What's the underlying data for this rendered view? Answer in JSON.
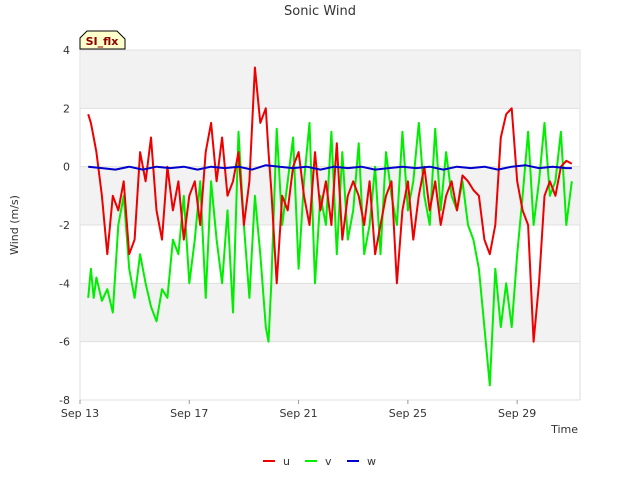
{
  "chart_data": {
    "type": "line",
    "title": "Sonic Wind",
    "badge": "SI_flx",
    "xlabel": "Time",
    "ylabel": "Wind (m/s)",
    "ylim": [
      -8,
      4
    ],
    "yticks": [
      "4",
      "2",
      "0",
      "-2",
      "-4",
      "-6",
      "-8"
    ],
    "x_ticks": [
      {
        "label": "Sep 13",
        "day": 13
      },
      {
        "label": "Sep 17",
        "day": 17
      },
      {
        "label": "Sep 21",
        "day": 21
      },
      {
        "label": "Sep 25",
        "day": 25
      },
      {
        "label": "Sep 29",
        "day": 29
      }
    ],
    "xlim_days": [
      13,
      31.3
    ],
    "grid": "horizontal bands",
    "legend_position": "bottom-center",
    "series": [
      {
        "name": "u",
        "color": "#ee0000",
        "x": [
          13.3,
          13.4,
          13.5,
          13.6,
          13.8,
          14.0,
          14.2,
          14.4,
          14.6,
          14.8,
          15.0,
          15.2,
          15.4,
          15.6,
          15.8,
          16.0,
          16.2,
          16.4,
          16.6,
          16.8,
          17.0,
          17.2,
          17.4,
          17.6,
          17.8,
          18.0,
          18.2,
          18.4,
          18.6,
          18.8,
          19.0,
          19.2,
          19.4,
          19.6,
          19.8,
          19.9,
          20.0,
          20.2,
          20.4,
          20.6,
          20.8,
          21.0,
          21.2,
          21.4,
          21.6,
          21.8,
          22.0,
          22.2,
          22.4,
          22.6,
          22.8,
          23.0,
          23.2,
          23.4,
          23.6,
          23.8,
          24.0,
          24.2,
          24.4,
          24.6,
          24.8,
          25.0,
          25.2,
          25.4,
          25.6,
          25.8,
          26.0,
          26.2,
          26.4,
          26.6,
          26.8,
          27.0,
          27.2,
          27.4,
          27.6,
          27.8,
          28.0,
          28.2,
          28.4,
          28.6,
          28.8,
          29.0,
          29.2,
          29.4,
          29.6,
          29.8,
          30.0,
          30.2,
          30.4,
          30.6,
          30.8,
          31.0
        ],
        "y": [
          1.8,
          1.5,
          1.0,
          0.5,
          -1.0,
          -3.0,
          -1.0,
          -1.5,
          -0.5,
          -3.0,
          -2.5,
          0.5,
          -0.5,
          1.0,
          -1.5,
          -2.5,
          0.0,
          -1.5,
          -0.5,
          -2.5,
          -1.0,
          -0.5,
          -2.0,
          0.5,
          1.5,
          -0.5,
          1.0,
          -1.0,
          -0.5,
          0.5,
          -2.0,
          -0.5,
          3.4,
          1.5,
          2.0,
          0.5,
          -0.8,
          -4.0,
          -1.0,
          -1.5,
          0.0,
          0.5,
          -1.0,
          -2.0,
          0.5,
          -1.5,
          -0.5,
          -2.0,
          0.8,
          -2.5,
          -1.0,
          -0.5,
          -1.0,
          -2.0,
          -0.5,
          -3.0,
          -2.0,
          -1.0,
          -0.5,
          -4.0,
          -1.5,
          -0.5,
          -2.5,
          -1.0,
          0.0,
          -1.5,
          -0.5,
          -2.0,
          -1.0,
          -0.5,
          -1.5,
          -0.3,
          -0.5,
          -0.8,
          -1.0,
          -2.5,
          -3.0,
          -2.0,
          1.0,
          1.8,
          2.0,
          -0.5,
          -1.5,
          -2.0,
          -6.0,
          -4.0,
          -1.0,
          -0.5,
          -1.0,
          0.0,
          0.2,
          0.1
        ]
      },
      {
        "name": "v",
        "color": "#00ee00",
        "x": [
          13.3,
          13.4,
          13.5,
          13.6,
          13.8,
          14.0,
          14.2,
          14.4,
          14.6,
          14.8,
          15.0,
          15.2,
          15.4,
          15.6,
          15.8,
          16.0,
          16.2,
          16.4,
          16.6,
          16.8,
          17.0,
          17.2,
          17.4,
          17.6,
          17.8,
          18.0,
          18.2,
          18.4,
          18.6,
          18.8,
          19.0,
          19.2,
          19.4,
          19.6,
          19.8,
          19.9,
          20.0,
          20.2,
          20.4,
          20.6,
          20.8,
          21.0,
          21.2,
          21.4,
          21.6,
          21.8,
          22.0,
          22.2,
          22.4,
          22.6,
          22.8,
          23.0,
          23.2,
          23.4,
          23.6,
          23.8,
          24.0,
          24.2,
          24.4,
          24.6,
          24.8,
          25.0,
          25.2,
          25.4,
          25.6,
          25.8,
          26.0,
          26.2,
          26.4,
          26.6,
          26.8,
          27.0,
          27.2,
          27.4,
          27.6,
          27.8,
          28.0,
          28.2,
          28.4,
          28.6,
          28.8,
          29.0,
          29.2,
          29.4,
          29.6,
          29.8,
          30.0,
          30.2,
          30.4,
          30.6,
          30.8,
          31.0
        ],
        "y": [
          -4.5,
          -3.5,
          -4.5,
          -3.8,
          -4.6,
          -4.2,
          -5.0,
          -2.0,
          -1.0,
          -3.5,
          -4.5,
          -3.0,
          -4.0,
          -4.8,
          -5.3,
          -4.2,
          -4.5,
          -2.5,
          -3.0,
          -1.0,
          -4.0,
          -2.5,
          -0.5,
          -4.5,
          -0.5,
          -2.5,
          -4.0,
          -1.5,
          -5.0,
          1.2,
          -2.0,
          -4.5,
          -1.0,
          -3.0,
          -5.5,
          -6.0,
          -4.0,
          1.3,
          -2.0,
          -0.5,
          1.0,
          -3.5,
          -0.5,
          1.5,
          -4.0,
          -1.0,
          -2.0,
          1.2,
          -3.0,
          0.5,
          -2.5,
          -1.5,
          0.8,
          -3.0,
          -2.0,
          0.0,
          -3.0,
          0.5,
          -1.0,
          -2.0,
          1.2,
          -1.5,
          -0.5,
          1.5,
          -1.0,
          -2.0,
          1.3,
          -1.5,
          0.5,
          -1.0,
          -1.5,
          -0.5,
          -2.0,
          -2.5,
          -3.5,
          -5.5,
          -7.5,
          -3.5,
          -5.5,
          -4.0,
          -5.5,
          -3.0,
          -1.0,
          1.2,
          -2.0,
          -0.5,
          1.5,
          -1.0,
          -0.5,
          1.2,
          -2.0,
          -0.5
        ]
      },
      {
        "name": "w",
        "color": "#0000cc",
        "x": [
          13.3,
          13.8,
          14.3,
          14.8,
          15.3,
          15.8,
          16.3,
          16.8,
          17.3,
          17.8,
          18.3,
          18.8,
          19.3,
          19.8,
          20.3,
          20.8,
          21.3,
          21.8,
          22.3,
          22.8,
          23.3,
          23.8,
          24.3,
          24.8,
          25.3,
          25.8,
          26.3,
          26.8,
          27.3,
          27.8,
          28.3,
          28.8,
          29.3,
          29.8,
          30.3,
          30.8,
          31.0
        ],
        "y": [
          0.0,
          -0.05,
          -0.1,
          0.0,
          -0.1,
          0.0,
          -0.05,
          0.0,
          -0.1,
          0.0,
          -0.05,
          0.0,
          -0.1,
          0.05,
          0.0,
          -0.05,
          0.0,
          -0.1,
          0.0,
          -0.05,
          0.0,
          -0.1,
          -0.05,
          0.0,
          -0.05,
          0.0,
          -0.1,
          0.0,
          -0.05,
          0.0,
          -0.1,
          0.0,
          0.05,
          -0.05,
          0.0,
          -0.05,
          -0.05
        ]
      }
    ]
  }
}
